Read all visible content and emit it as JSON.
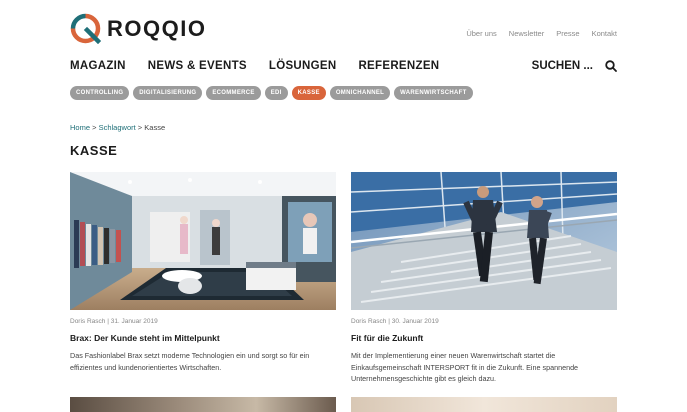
{
  "brand": {
    "name": "ROQQIO",
    "accent": "#d9653b",
    "teal": "#1f6f78"
  },
  "meta_nav": [
    "Über uns",
    "Newsletter",
    "Presse",
    "Kontakt"
  ],
  "main_nav": [
    "MAGAZIN",
    "NEWS & EVENTS",
    "LÖSUNGEN",
    "REFERENZEN"
  ],
  "search": {
    "label": "SUCHEN ...",
    "icon": "search-icon"
  },
  "tags": [
    {
      "label": "CONTROLLING",
      "active": false
    },
    {
      "label": "DIGITALISIERUNG",
      "active": false
    },
    {
      "label": "ECOMMERCE",
      "active": false
    },
    {
      "label": "EDI",
      "active": false
    },
    {
      "label": "KASSE",
      "active": true
    },
    {
      "label": "OMNICHANNEL",
      "active": false
    },
    {
      "label": "WARENWIRTSCHAFT",
      "active": false
    }
  ],
  "breadcrumb": {
    "home": "Home",
    "sep1": ">",
    "section": "Schlagwort",
    "sep2": ">",
    "current": "Kasse"
  },
  "page_title": "KASSE",
  "articles": [
    {
      "meta": "Doris Rasch | 31. Januar 2019",
      "title": "Brax: Der Kunde steht im Mittelpunkt",
      "excerpt": "Das Fashionlabel Brax setzt moderne Technologien ein und sorgt so für ein effizientes und kundenorientiertes Wirtschaften."
    },
    {
      "meta": "Doris Rasch | 30. Januar 2019",
      "title": "Fit für die Zukunft",
      "excerpt": "Mit der Implementierung einer neuen Warenwirtschaft startet die Einkaufsgemeinschaft INTERSPORT fit in die Zukunft. Eine spannende Unternehmensgeschichte gibt es gleich dazu."
    }
  ]
}
